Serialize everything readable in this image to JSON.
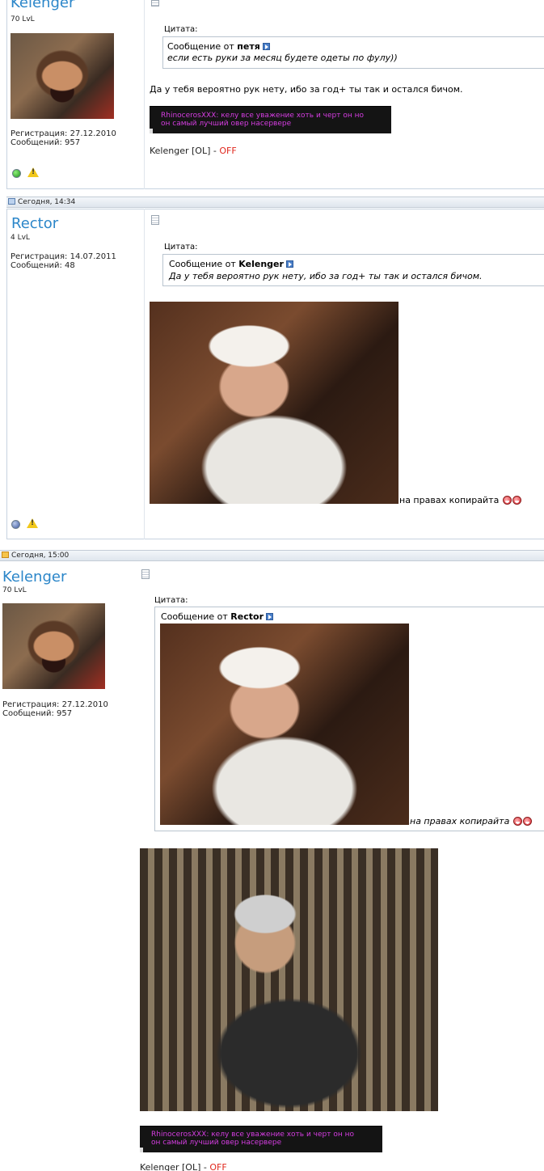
{
  "posts": [
    {
      "username": "Kelenger",
      "level": "70 LvL",
      "registration": "Регистрация: 27.12.2010",
      "messages": "Сообщений: 957",
      "quote_label": "Цитата:",
      "quote_prefix": "Сообщение от",
      "quote_author": "петя",
      "quote_text": "если есть руки за месяц будете одеты по фулу))",
      "text": "Да у тебя вероятно рук нету, ибо за год+ ты так и остался бичом.",
      "signature_lines": [
        "RhinocerosXXX: келу все уважение хоть и черт он но",
        "он самый лучший овер насервере"
      ],
      "status_name": "Kelenger [OL] -",
      "status_value": "OFF"
    },
    {
      "date": "Сегодня, 14:34",
      "username": "Rector",
      "level": "4 LvL",
      "registration": "Регистрация: 14.07.2011",
      "messages": "Сообщений: 48",
      "quote_label": "Цитата:",
      "quote_prefix": "Сообщение от",
      "quote_author": "Kelenger",
      "quote_text": "Да у тебя вероятно рук нету, ибо за год+ ты так и остался бичом.",
      "caption": "на правах копирайта"
    },
    {
      "date": "Сегодня, 15:00",
      "username": "Kelenger",
      "level": "70 LvL",
      "registration": "Регистрация: 27.12.2010",
      "messages": "Сообщений: 957",
      "quote_label": "Цитата:",
      "quote_prefix": "Сообщение от",
      "quote_author": "Rector",
      "quote_caption": "на правах копирайта",
      "signature_lines": [
        "RhinocerosXXX: келу все уважение хоть и черт он но",
        "он самый лучший овер насервере"
      ],
      "status_name": "Kelenger [OL] -",
      "status_value": "OFF"
    }
  ],
  "colors": {
    "username": "#2b86c9",
    "off": "#e0261c",
    "signature": "#d43de0"
  }
}
